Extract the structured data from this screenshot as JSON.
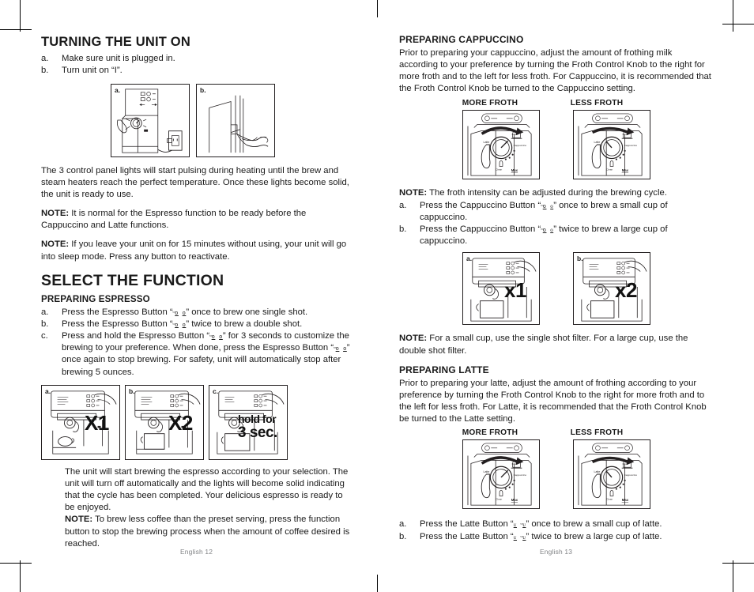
{
  "document": {
    "type": "appliance-instruction-manual-spread",
    "ink_color": "#231f20",
    "folio_color": "#808285"
  },
  "left_page": {
    "folio": "English 12",
    "turning_on": {
      "heading": "TURNING THE UNIT ON",
      "steps": [
        {
          "marker": "a.",
          "text": "Make sure unit is plugged in."
        },
        {
          "marker": "b.",
          "text": "Turn unit on “I”."
        }
      ],
      "figures": [
        {
          "label": "a.",
          "caption_name": "machine-plugged-into-outlet"
        },
        {
          "label": "b.",
          "caption_name": "hand-turning-power-switch"
        }
      ],
      "paragraph": "The 3 control panel lights will start pulsing during heating until the brew and steam heaters reach the perfect temperature. Once these lights become solid, the unit is ready to use.",
      "note1_label": "NOTE:",
      "note1_text": "It is normal for the Espresso function to be ready before the Cappuccino and Latte functions.",
      "note2_label": "NOTE:",
      "note2_text": "If you leave your unit on for 15 minutes without using, your unit will go into sleep mode.  Press any button to reactivate."
    },
    "select_function": {
      "heading": "SELECT THE FUNCTION",
      "espresso": {
        "heading": "PREPARING ESPRESSO",
        "steps": [
          {
            "marker": "a.",
            "pre": "Press the Espresso Button “",
            "glyph": "espresso-button-icon",
            "post": "” once to brew one single shot."
          },
          {
            "marker": "b.",
            "pre": "Press the Espresso Button “",
            "glyph": "espresso-button-icon",
            "post": "” twice to brew a double shot."
          },
          {
            "marker": "c.",
            "pre": "Press and hold the Espresso Button “",
            "glyph": "espresso-button-icon",
            "post": "” for 3 seconds to customize the brewing to your preference. When done, press the Espresso Button “",
            "glyph2": "espresso-button-icon",
            "post2": "” once again to stop brewing. For safety, unit will automatically stop after brewing 5 ounces."
          }
        ],
        "figures": [
          {
            "label": "a.",
            "overlay": "X1"
          },
          {
            "label": "b.",
            "overlay": "X2"
          },
          {
            "label": "c.",
            "overlay_line1": "hold for",
            "overlay_line2": "3 sec."
          }
        ],
        "closing_paragraph": "The unit will start brewing the espresso according to your selection. The unit will turn off automatically and the lights will become solid indicating that the cycle has been completed. Your delicious espresso is ready to be enjoyed.",
        "closing_note_label": "NOTE:",
        "closing_note_text": "To brew less coffee than the preset serving, press the function button to stop the brewing process when the amount of coffee desired is reached."
      }
    }
  },
  "right_page": {
    "folio": "English 13",
    "cappuccino": {
      "heading": "PREPARING CAPPUCCINO",
      "paragraph": "Prior to preparing your cappuccino, adjust the amount of frothing milk according to your preference by turning the Froth Control Knob to the right for more froth and to the left for less froth. For Cappuccino, it is recommended that the Froth Control Knob be turned to the Cappuccino setting.",
      "froth_labels": [
        "MORE FROTH",
        "LESS FROTH"
      ],
      "knob_figures": [
        {
          "name": "froth-knob-more-froth",
          "dial_labels": [
            "Latte",
            "Froth",
            "Cappuccino",
            "Clean",
            "Max"
          ]
        },
        {
          "name": "froth-knob-less-froth",
          "dial_labels": [
            "Latte",
            "Froth",
            "Cappuccino",
            "Clean",
            "Max"
          ]
        }
      ],
      "note_label": "NOTE:",
      "note_text": "The froth intensity can be adjusted during the brewing cycle.",
      "steps": [
        {
          "marker": "a.",
          "pre": "Press the Cappuccino Button “",
          "glyph": "cappuccino-button-icon",
          "post": "” once to brew a small cup of cappuccino."
        },
        {
          "marker": "b.",
          "pre": "Press the Cappuccino Button “",
          "glyph": "cappuccino-button-icon",
          "post": "” twice to brew a large cup of cappuccino."
        }
      ],
      "figures": [
        {
          "label": "a.",
          "overlay": "x1"
        },
        {
          "label": "b.",
          "overlay": "x2"
        }
      ],
      "filter_note_label": "NOTE:",
      "filter_note_text": "For a small cup, use the single shot filter.  For a large cup, use the double shot filter."
    },
    "latte": {
      "heading": "PREPARING LATTE",
      "paragraph": "Prior to preparing your latte, adjust the amount of frothing according to your preference by turning the Froth Control Knob to the right for more froth and to the left for less froth. For Latte, it is recommended that the Froth Control Knob be turned to the Latte setting.",
      "froth_labels": [
        "MORE FROTH",
        "LESS FROTH"
      ],
      "knob_figures": [
        {
          "name": "froth-knob-more-froth",
          "dial_labels": [
            "Latte",
            "Froth",
            "Cappuccino",
            "Clean",
            "Max"
          ]
        },
        {
          "name": "froth-knob-less-froth",
          "dial_labels": [
            "Latte",
            "Froth",
            "Cappuccino",
            "Clean",
            "Max"
          ]
        }
      ],
      "steps": [
        {
          "marker": "a.",
          "pre": "Press the Latte Button “",
          "glyph": "latte-button-icon",
          "post": "” once to brew a small cup of latte."
        },
        {
          "marker": "b.",
          "pre": "Press the Latte Button “",
          "glyph": "latte-button-icon",
          "post": "” twice to brew a large cup of latte."
        }
      ]
    }
  }
}
